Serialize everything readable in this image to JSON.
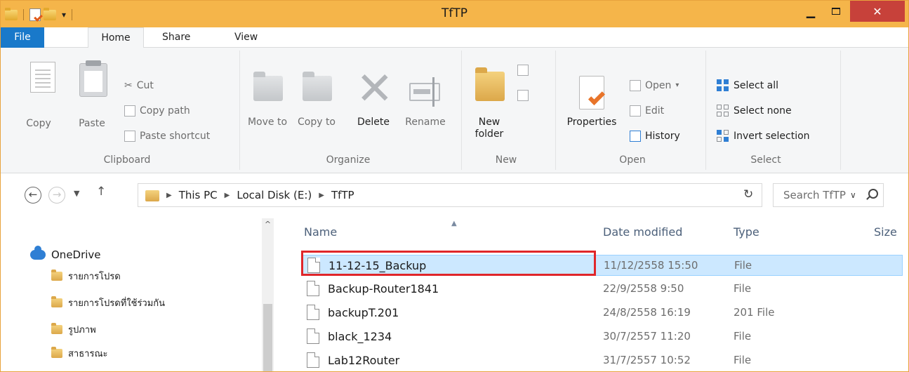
{
  "window": {
    "title": "TfTP"
  },
  "tabs": {
    "file": "File",
    "home": "Home",
    "share": "Share",
    "view": "View"
  },
  "ribbon": {
    "clipboard": {
      "label": "Clipboard",
      "copy": "Copy",
      "paste": "Paste",
      "cut": "Cut",
      "copy_path": "Copy path",
      "paste_shortcut": "Paste shortcut"
    },
    "organize": {
      "label": "Organize",
      "move_to": "Move to",
      "copy_to": "Copy to",
      "delete": "Delete",
      "rename": "Rename"
    },
    "new": {
      "label": "New",
      "new_folder": "New folder"
    },
    "open": {
      "label": "Open",
      "properties": "Properties",
      "open": "Open",
      "edit": "Edit",
      "history": "History"
    },
    "select": {
      "label": "Select",
      "select_all": "Select all",
      "select_none": "Select none",
      "invert_selection": "Invert selection"
    }
  },
  "address": {
    "crumbs": [
      "This PC",
      "Local Disk (E:)",
      "TfTP"
    ],
    "search_placeholder": "Search TfTP"
  },
  "navpane": {
    "items": [
      {
        "label": "OneDrive",
        "icon": "onedrive-cloud-icon"
      },
      {
        "label": "รายการโปรด",
        "icon": "folder-icon"
      },
      {
        "label": "รายการโปรดที่ใช้ร่วมกัน",
        "icon": "folder-icon"
      },
      {
        "label": "รูปภาพ",
        "icon": "folder-icon"
      },
      {
        "label": "สาธารณะ",
        "icon": "folder-icon"
      }
    ]
  },
  "filelist": {
    "columns": {
      "name": "Name",
      "date": "Date modified",
      "type": "Type",
      "size": "Size"
    },
    "rows": [
      {
        "name": "11-12-15_Backup",
        "date": "11/12/2558 15:50",
        "type": "File",
        "selected": true
      },
      {
        "name": "Backup-Router1841",
        "date": "22/9/2558 9:50",
        "type": "File",
        "selected": false
      },
      {
        "name": "backupT.201",
        "date": "24/8/2558 16:19",
        "type": "201 File",
        "selected": false
      },
      {
        "name": "black_1234",
        "date": "30/7/2557 11:20",
        "type": "File",
        "selected": false
      },
      {
        "name": "Lab12Router",
        "date": "31/7/2557 10:52",
        "type": "File",
        "selected": false
      }
    ]
  },
  "colors": {
    "accent": "#1979ca",
    "titlebar": "#f5b54a",
    "close": "#c7413a",
    "selection": "#cce8ff",
    "highlight": "#e0262a"
  }
}
